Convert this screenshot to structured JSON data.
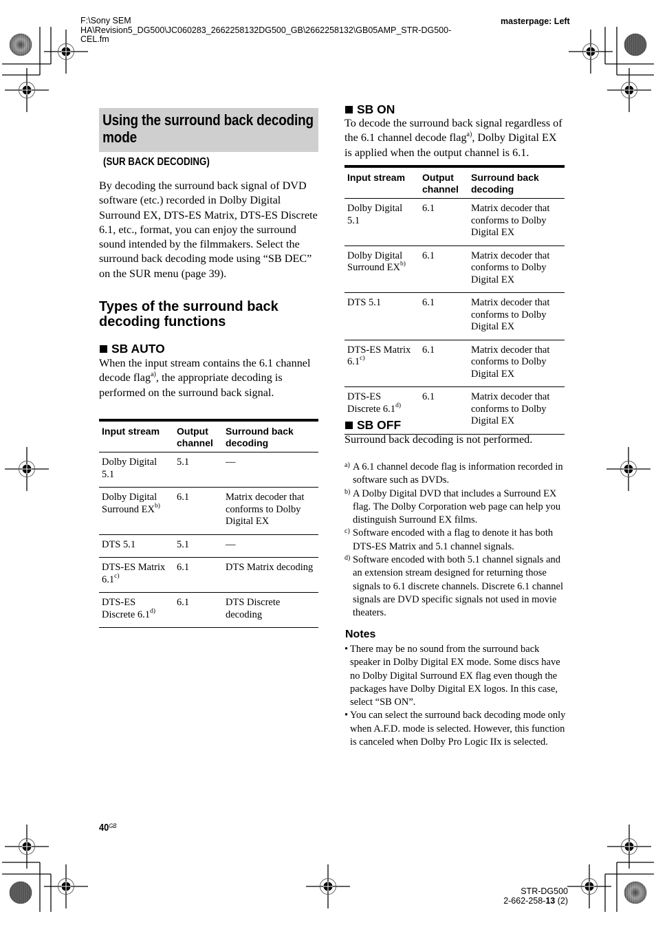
{
  "header": {
    "file_path_lines": [
      "F:\\Sony SEM",
      "HA\\Revision5_DG500\\JC060283_2662258132DG500_GB\\2662258132\\GB05AMP_STR-DG500-",
      "CEL.fm"
    ],
    "masterpage": "masterpage: Left"
  },
  "section": {
    "title": "Using the surround back decoding mode",
    "subtitle": "(SUR BACK DECODING)",
    "intro": "By decoding the surround back signal of DVD software (etc.) recorded in Dolby Digital Surround EX, DTS-ES Matrix, DTS-ES Discrete 6.1, etc., format, you can enjoy the surround sound intended by the filmmakers. Select the surround back decoding mode using “SB DEC” on the SUR menu (page 39)."
  },
  "types_heading": "Types of the surround back decoding functions",
  "sb_auto": {
    "heading": "SB AUTO",
    "text_before": "When the input stream contains the 6.1 channel decode flag",
    "text_mark": "a)",
    "text_after": ", the appropriate decoding is performed on the surround back signal.",
    "table": {
      "headers": [
        "Input stream",
        "Output channel",
        "Surround back decoding"
      ],
      "rows": [
        {
          "input": "Dolby Digital 5.1",
          "mark": "",
          "output": "5.1",
          "decoding": "—"
        },
        {
          "input": "Dolby Digital Surround EX",
          "mark": "b)",
          "output": "6.1",
          "decoding": "Matrix decoder that conforms to Dolby Digital EX"
        },
        {
          "input": "DTS 5.1",
          "mark": "",
          "output": "5.1",
          "decoding": "—"
        },
        {
          "input": "DTS-ES Matrix 6.1",
          "mark": "c)",
          "output": "6.1",
          "decoding": "DTS Matrix decoding"
        },
        {
          "input": "DTS-ES Discrete 6.1",
          "mark": "d)",
          "output": "6.1",
          "decoding": "DTS Discrete decoding"
        }
      ]
    }
  },
  "sb_on": {
    "heading": "SB ON",
    "text_before": "To decode the surround back signal regardless of the 6.1 channel decode flag",
    "text_mark": "a)",
    "text_after": ", Dolby Digital EX is applied when the output channel is 6.1.",
    "table": {
      "headers": [
        "Input stream",
        "Output channel",
        "Surround back decoding"
      ],
      "rows": [
        {
          "input": "Dolby Digital 5.1",
          "mark": "",
          "output": "6.1",
          "decoding": "Matrix decoder that conforms to Dolby Digital EX"
        },
        {
          "input": "Dolby Digital Surround EX",
          "mark": "b)",
          "output": "6.1",
          "decoding": "Matrix decoder that conforms to Dolby Digital EX"
        },
        {
          "input": "DTS 5.1",
          "mark": "",
          "output": "6.1",
          "decoding": "Matrix decoder that conforms to Dolby Digital EX"
        },
        {
          "input": "DTS-ES Matrix 6.1",
          "mark": "c)",
          "output": "6.1",
          "decoding": "Matrix decoder that conforms to Dolby Digital EX"
        },
        {
          "input": "DTS-ES Discrete 6.1",
          "mark": "d)",
          "output": "6.1",
          "decoding": "Matrix decoder that conforms to Dolby Digital EX"
        }
      ]
    }
  },
  "sb_off": {
    "heading": "SB OFF",
    "text": "Surround back decoding is not performed."
  },
  "footnotes": [
    {
      "mark": "a)",
      "text": "A 6.1 channel decode flag is information recorded in software such as DVDs."
    },
    {
      "mark": "b)",
      "text": "A Dolby Digital DVD that includes a Surround EX flag. The Dolby Corporation web page can help you distinguish Surround EX films."
    },
    {
      "mark": "c)",
      "text": "Software encoded with a flag to denote it has both DTS-ES Matrix and 5.1 channel signals."
    },
    {
      "mark": "d)",
      "text": "Software encoded with both 5.1 channel signals and an extension stream designed for returning those signals to 6.1 discrete channels. Discrete 6.1 channel signals are DVD specific signals not used in movie theaters."
    }
  ],
  "notes": {
    "heading": "Notes",
    "bullet": "•",
    "items": [
      "There may be no sound from the surround back speaker in Dolby Digital EX mode. Some discs have no Dolby Digital Surround EX flag even though the packages have Dolby Digital EX logos. In this case, select “SB ON”.",
      "You can select the surround back decoding mode only when A.F.D. mode is selected. However, this function is canceled when Dolby Pro Logic IIx is selected."
    ]
  },
  "footer": {
    "page_number": "40",
    "page_suffix": "GB",
    "model": "STR-DG500",
    "code_prefix": "2-662-258-",
    "code_bold": "13",
    "code_suffix": " (2)"
  },
  "print_marks": {
    "registration_mark_icon": "crosshair-target-icon",
    "color_disc_icon": "radial-calibration-disc-icon"
  }
}
